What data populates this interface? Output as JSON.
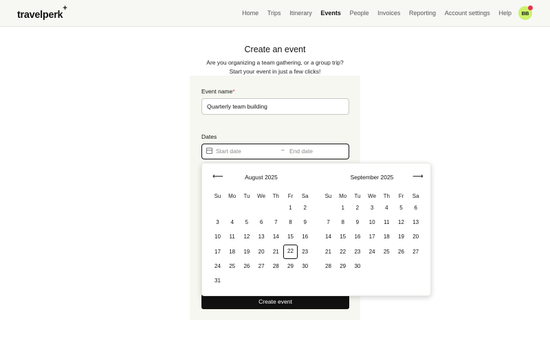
{
  "header": {
    "logo": "travelperk",
    "logo_plus": "+",
    "nav": [
      "Home",
      "Trips",
      "Itinerary",
      "Events",
      "People",
      "Invoices",
      "Reporting",
      "Account settings",
      "Help"
    ],
    "active_nav": "Events",
    "avatar_initials": "BB"
  },
  "page": {
    "title": "Create an event",
    "subtitle_line1": "Are you organizing a team gathering, or a group trip?",
    "subtitle_line2": "Start your event in just a few clicks!"
  },
  "form": {
    "event_name_label": "Event name",
    "required_mark": "*",
    "event_name_value": "Quarterly team building",
    "dates_label": "Dates",
    "start_placeholder": "Start date",
    "end_placeholder": "End date",
    "dash": "–",
    "create_button": "Create event"
  },
  "calendar": {
    "prev_arrow": "⟵",
    "next_arrow": "⟶",
    "weekdays": [
      "Su",
      "Mo",
      "Tu",
      "We",
      "Th",
      "Fr",
      "Sa"
    ],
    "selected_day": "22",
    "selected_month_index": 0,
    "months": [
      {
        "title": "August 2025",
        "weeks": [
          [
            "",
            "",
            "",
            "",
            "",
            "1",
            "2"
          ],
          [
            "3",
            "4",
            "5",
            "6",
            "7",
            "8",
            "9"
          ],
          [
            "10",
            "11",
            "12",
            "13",
            "14",
            "15",
            "16"
          ],
          [
            "17",
            "18",
            "19",
            "20",
            "21",
            "22",
            "23"
          ],
          [
            "24",
            "25",
            "26",
            "27",
            "28",
            "29",
            "30"
          ],
          [
            "31",
            "",
            "",
            "",
            "",
            "",
            ""
          ]
        ]
      },
      {
        "title": "September 2025",
        "weeks": [
          [
            "",
            "1",
            "2",
            "3",
            "4",
            "5",
            "6"
          ],
          [
            "7",
            "8",
            "9",
            "10",
            "11",
            "12",
            "13"
          ],
          [
            "14",
            "15",
            "16",
            "17",
            "18",
            "19",
            "20"
          ],
          [
            "21",
            "22",
            "23",
            "24",
            "25",
            "26",
            "27"
          ],
          [
            "28",
            "29",
            "30",
            "",
            "",
            "",
            ""
          ]
        ]
      }
    ]
  }
}
